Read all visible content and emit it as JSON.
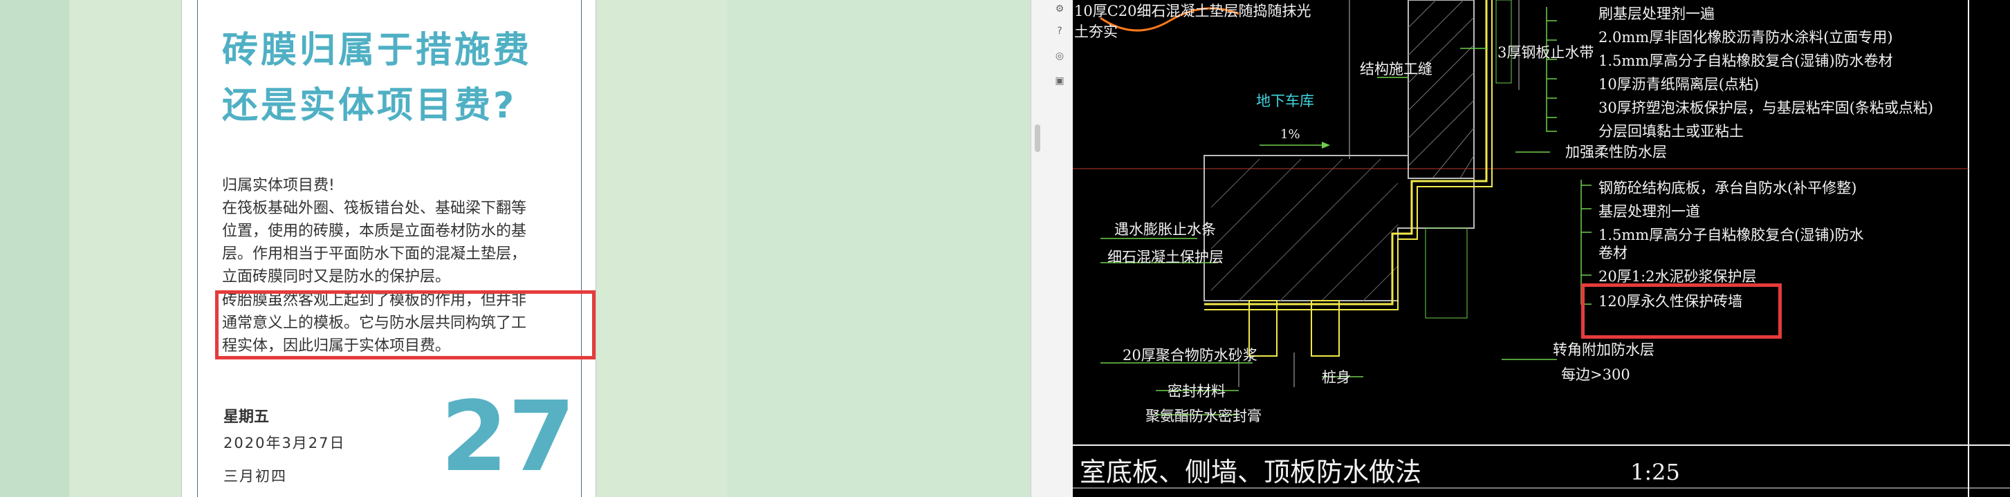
{
  "article": {
    "title_line1": "砖膜归属于措施费",
    "title_line2": "还是实体项目费?",
    "para1_line1": "归属实体项目费!",
    "para1_line2": "在筏板基础外圈、筏板错台处、基础梁下翻等",
    "para1_line3": "位置，使用的砖膜，本质是立面卷材防水的基",
    "para1_line4": "层。作用相当于平面防水下面的混凝土垫层，",
    "para1_line5": "立面砖膜同时又是防水的保护层。",
    "para2_line1": "砖胎膜虽然客观上起到了模板的作用，但并非",
    "para2_line2": "通常意义上的模板。它与防水层共同构筑了工",
    "para2_line3": "程实体，因此归属于实体项目费。",
    "weekday": "星期五",
    "date": "2020年3月27日",
    "lunar": "三月初四",
    "day": "27"
  },
  "cad": {
    "labels": {
      "top_left": "10厚C20细石混凝土垫层随捣随抹光",
      "top_left2": "土夯实",
      "struct_joint": "结构施工缝",
      "steel_stop": "3厚钢板止水带",
      "basement": "地下车库",
      "slope": "1%",
      "r1": "刷基层处理剂一遍",
      "r2": "2.0mm厚非固化橡胶沥青防水涂料(立面专用)",
      "r3": "1.5mm厚高分子自粘橡胶复合(湿铺)防水卷材",
      "r4": "10厚沥青纸隔离层(点粘)",
      "r5": "30厚挤塑泡沫板保护层，与基层粘牢固(条粘或点粘)",
      "r6": "分层回填黏土或亚粘土",
      "r7": "加强柔性防水层",
      "r8": "钢筋砼结构底板，承台自防水(补平修整)",
      "r9": "基层处理剂一道",
      "r10": "1.5mm厚高分子自粘橡胶复合(湿铺)防水",
      "r10b": "卷材",
      "r11": "20厚1:2水泥砂浆保护层",
      "r12": "120厚永久性保护砖墙",
      "r13": "转角附加防水层",
      "r14": "每边>300",
      "l1": "遇水膨胀止水条",
      "l2": "细石混凝土保护层",
      "l3": "20厚聚合物防水砂浆",
      "l4": "密封材料",
      "l5": "聚氨酯防水密封膏",
      "l6": "桩身"
    },
    "title": "室底板、侧墙、顶板防水做法",
    "scale": "1:25"
  },
  "colors": {
    "accent": "#4fb0c4",
    "highlight": "#e63b3b",
    "cad_bg": "#000000"
  }
}
